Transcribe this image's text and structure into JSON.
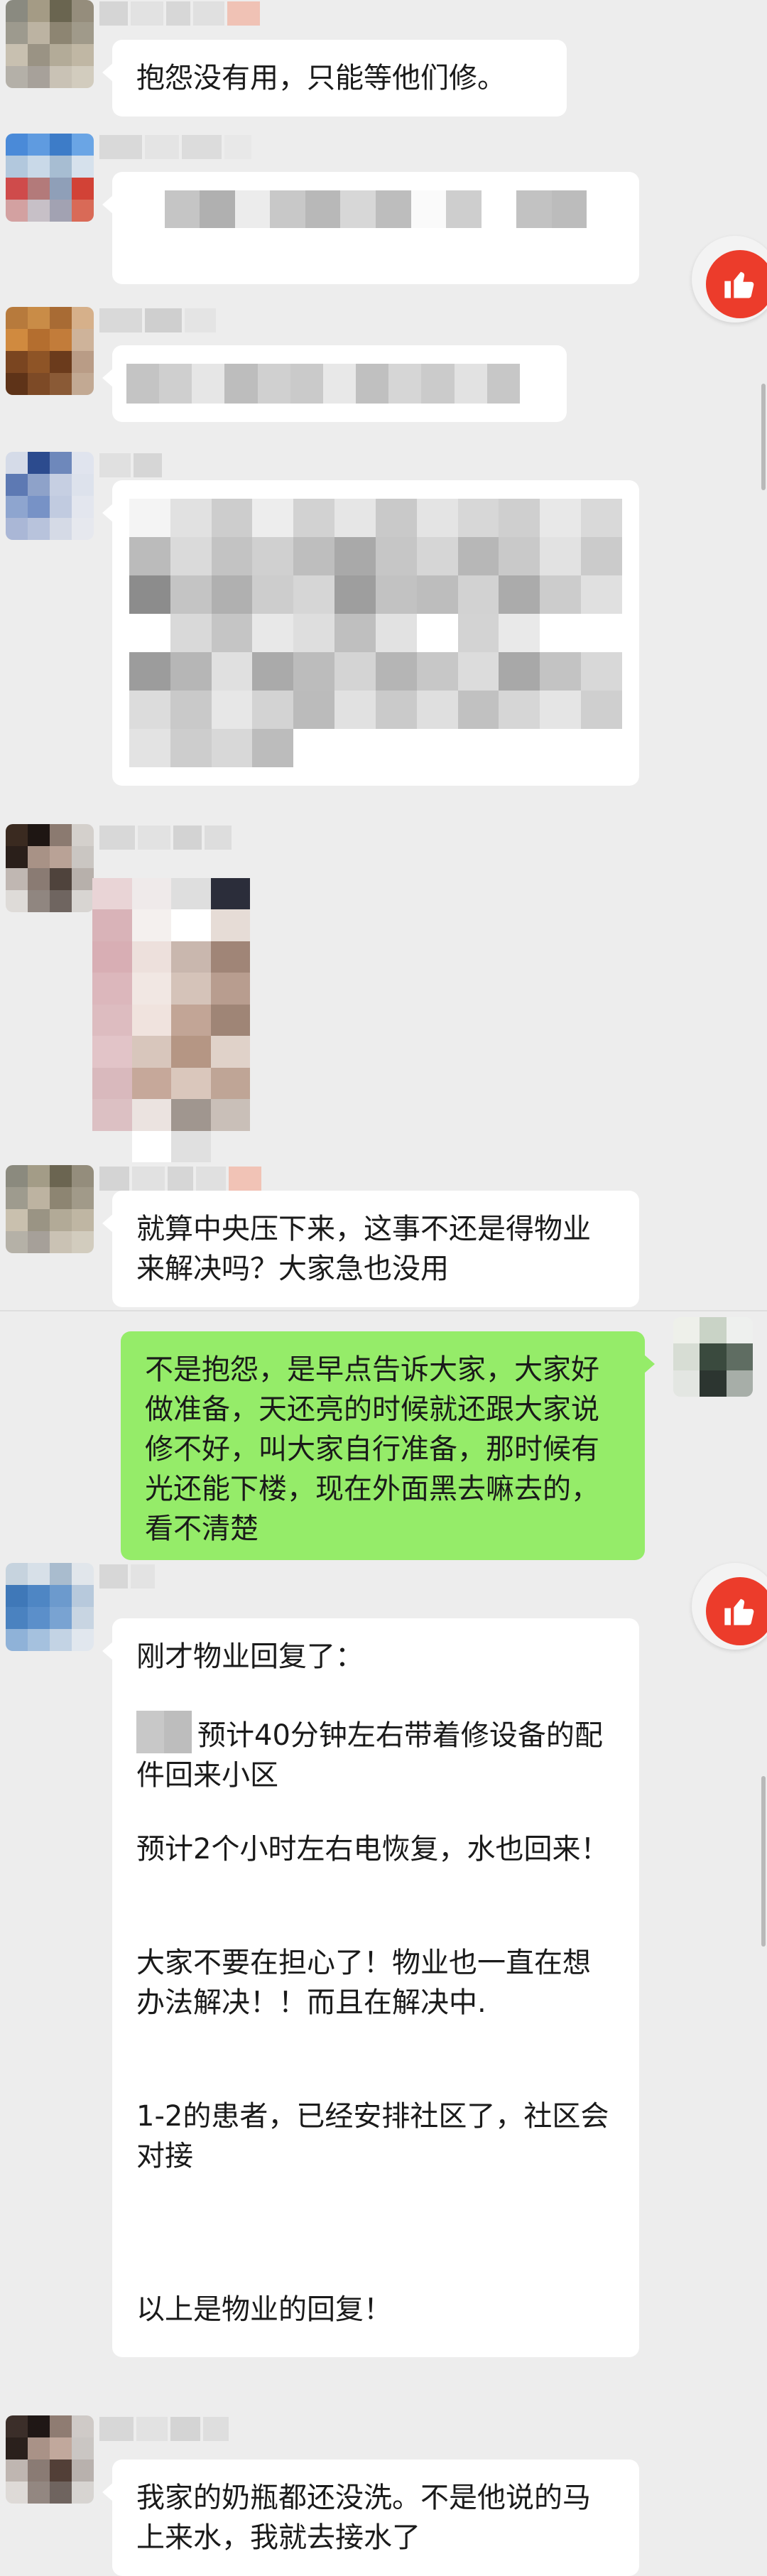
{
  "messages": [
    {
      "side": "left",
      "type": "text",
      "text": "抱怨没有用，只能等他们修。"
    },
    {
      "side": "left",
      "type": "pixelated-text"
    },
    {
      "side": "left",
      "type": "pixelated-text"
    },
    {
      "side": "left",
      "type": "pixelated-text"
    },
    {
      "side": "left",
      "type": "pixelated-image"
    },
    {
      "side": "left",
      "type": "text",
      "text": "就算中央压下来，这事不还是得物业来解决吗？大家急也没用"
    },
    {
      "side": "right",
      "type": "text",
      "text": "不是抱怨，是早点告诉大家，大家好做准备，天还亮的时候就还跟大家说修不好，叫大家自行准备，那时候有光还能下楼，现在外面黑去嘛去的，看不清楚"
    },
    {
      "side": "left",
      "type": "text",
      "lines": [
        "刚才物业回复了：",
        "预计40分钟左右带着修设备的配件回来小区",
        "预计2个小时左右电恢复，水也回来！",
        "大家不要在担心了！物业也一直在想办法解决！！而且在解决中.",
        "1-2的患者，已经安排社区了，社区会对接",
        "以上是物业的回复！"
      ]
    },
    {
      "side": "left",
      "type": "text",
      "text": "我家的奶瓶都还没洗。不是他说的马上来水，我就去接水了"
    }
  ],
  "icons": {
    "like": "thumbs-up-icon"
  },
  "colors": {
    "background": "#ededed",
    "sent_bubble": "#95ec69",
    "received_bubble": "#ffffff",
    "like_button": "#ec3c2b"
  }
}
